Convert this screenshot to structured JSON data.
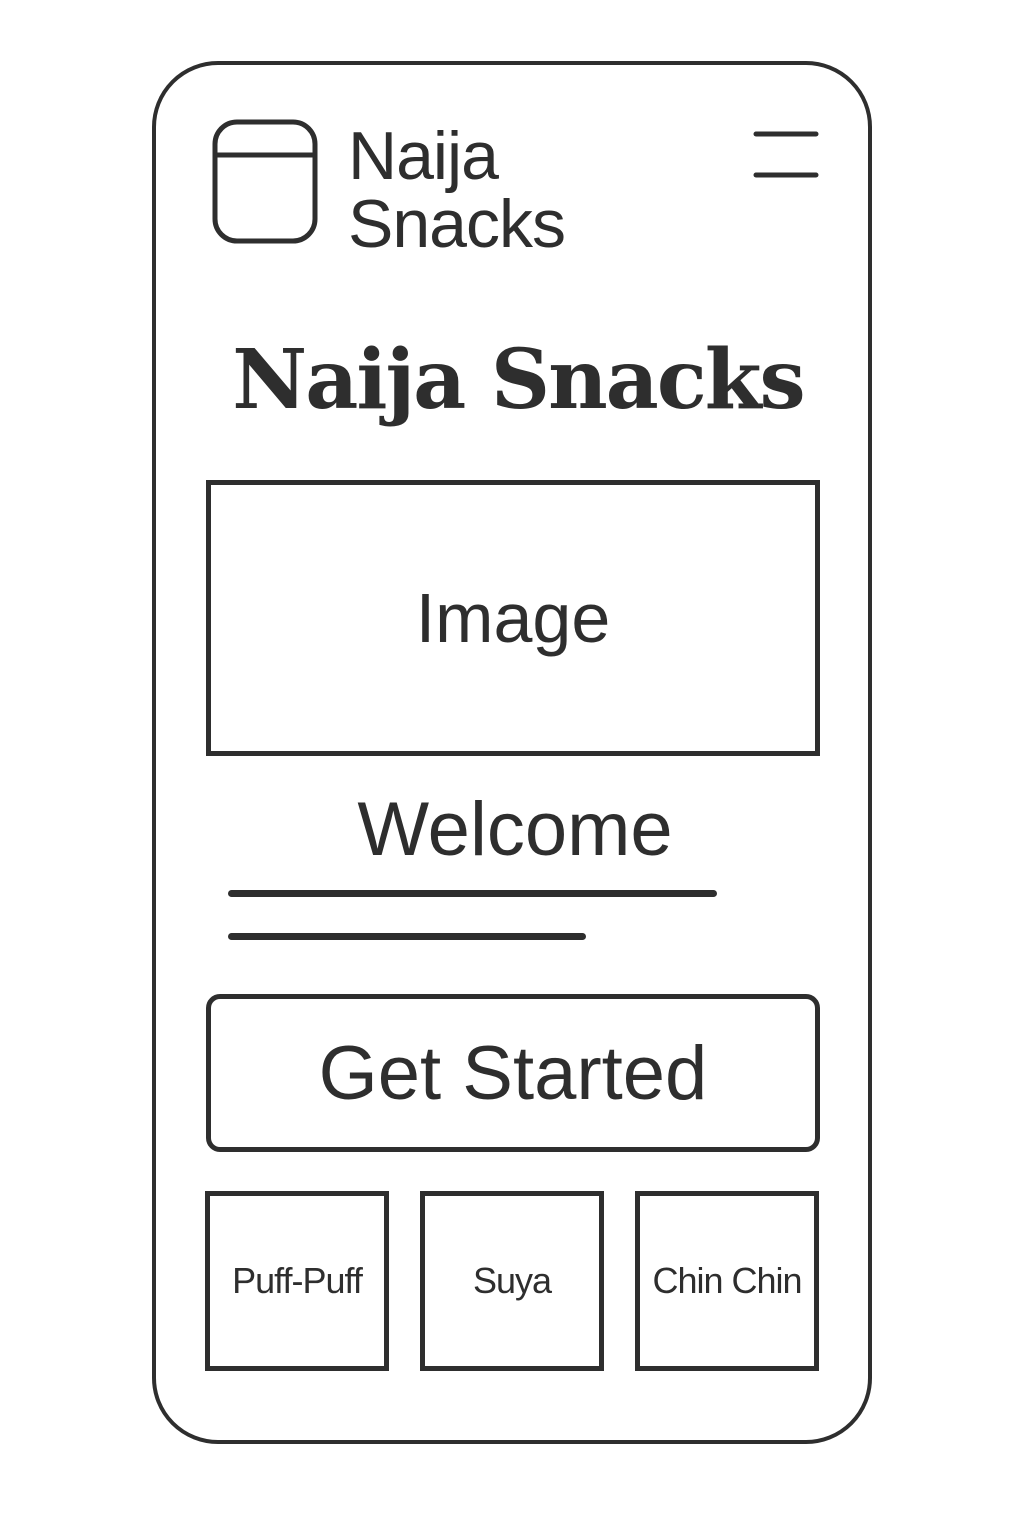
{
  "header": {
    "logo_line1": "Naija",
    "logo_line2": "Snacks",
    "logo_icon": "app-window-icon",
    "menu_icon": "hamburger-menu-icon"
  },
  "hero": {
    "title": "Naija Snacks",
    "image_label": "Image"
  },
  "welcome": {
    "heading": "Welcome"
  },
  "cta": {
    "label": "Get Started"
  },
  "snacks": [
    {
      "label": "Puff-Puff"
    },
    {
      "label": "Suya"
    },
    {
      "label": "Chin Chin"
    }
  ],
  "colors": {
    "stroke": "#2e2e2e",
    "background": "#ffffff"
  }
}
